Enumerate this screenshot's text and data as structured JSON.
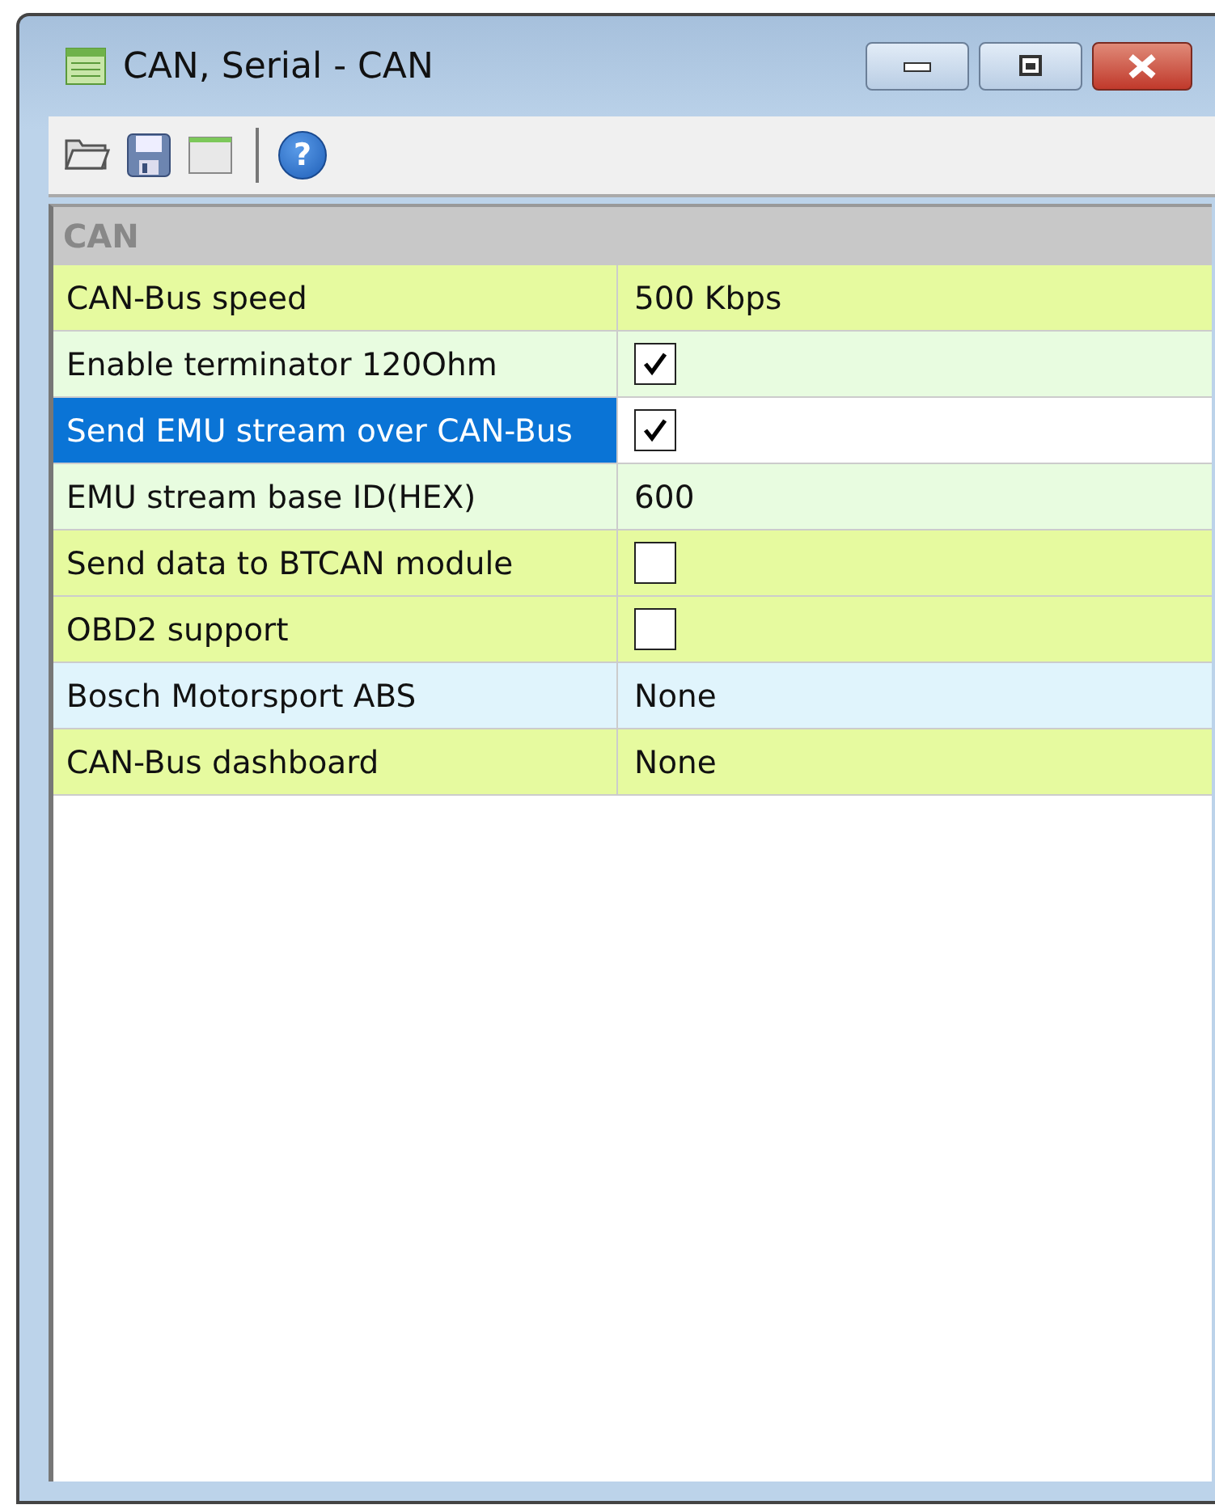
{
  "window": {
    "title": "CAN, Serial - CAN"
  },
  "toolbar": {
    "buttons": [
      {
        "kind": "open"
      },
      {
        "kind": "save"
      },
      {
        "kind": "window"
      },
      {
        "kind": "help",
        "glyph": "?"
      }
    ]
  },
  "grid": {
    "category": "CAN",
    "rows": [
      {
        "label": "CAN-Bus speed",
        "kind": "text",
        "value": "500 Kbps",
        "color": "#e6fa9f",
        "selected": false
      },
      {
        "label": "Enable terminator 120Ohm",
        "kind": "checkbox",
        "checked": true,
        "color": "#e8fce0",
        "selected": false
      },
      {
        "label": "Send EMU stream over CAN-Bus",
        "kind": "checkbox",
        "checked": true,
        "selected": true
      },
      {
        "label": "EMU stream base ID(HEX)",
        "kind": "text",
        "value": "600",
        "color": "#e8fce0",
        "selected": false
      },
      {
        "label": "Send data to BTCAN module",
        "kind": "checkbox",
        "checked": false,
        "color": "#e6fa9f",
        "selected": false
      },
      {
        "label": "OBD2 support",
        "kind": "checkbox",
        "checked": false,
        "color": "#e6fa9f",
        "selected": false
      },
      {
        "label": "Bosch Motorsport ABS",
        "kind": "text",
        "value": "None",
        "color": "#e0f4fc",
        "selected": false
      },
      {
        "label": "CAN-Bus dashboard",
        "kind": "text",
        "value": "None",
        "color": "#e6fa9f",
        "selected": false
      }
    ]
  }
}
